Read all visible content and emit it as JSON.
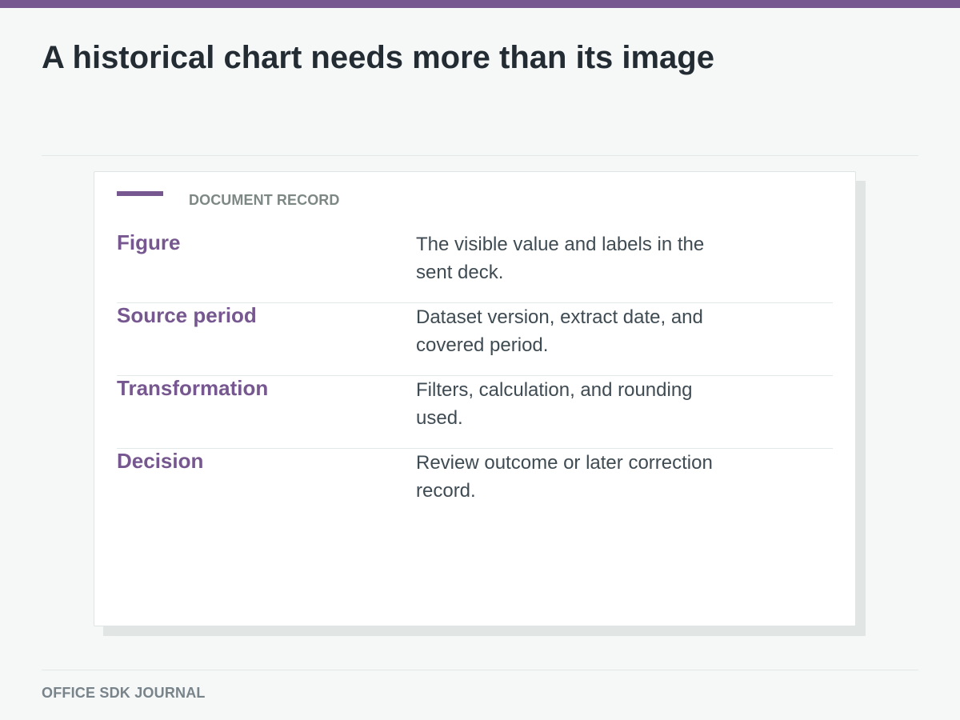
{
  "header": {
    "title": "A historical chart needs more than its image"
  },
  "card": {
    "label": "DOCUMENT RECORD",
    "rows": [
      {
        "key": "Figure",
        "value": "The visible value and labels in the sent deck."
      },
      {
        "key": "Source period",
        "value": "Dataset version, extract date, and covered period."
      },
      {
        "key": "Transformation",
        "value": "Filters, calculation, and rounding used."
      },
      {
        "key": "Decision",
        "value": "Review outcome or later correction record."
      }
    ]
  },
  "footer": {
    "label": "OFFICE SDK JOURNAL"
  },
  "colors": {
    "accent": "#76578f",
    "text_dark": "#232c33",
    "text_body": "#3f4b53",
    "text_muted": "#7d8885",
    "background": "#f6f8f8",
    "rule": "#e2e7e7"
  }
}
